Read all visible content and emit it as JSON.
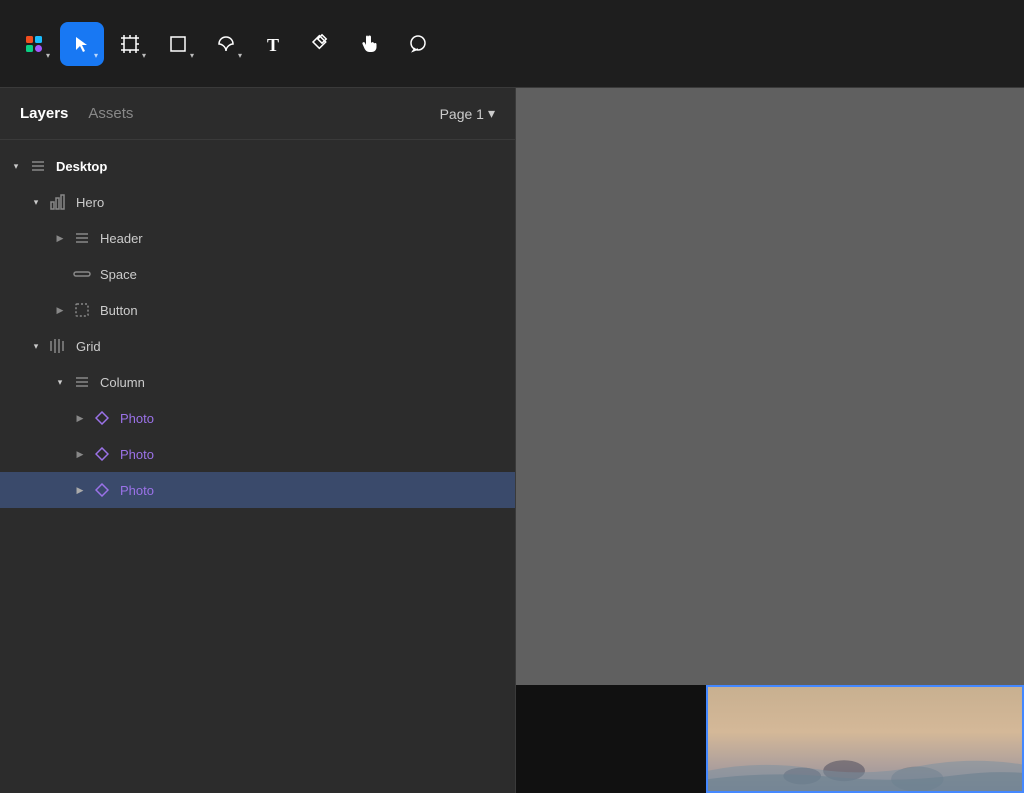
{
  "toolbar": {
    "tools": [
      {
        "name": "figma-menu",
        "icon": "⊞",
        "label": "Figma Menu",
        "hasChevron": true,
        "active": false
      },
      {
        "name": "move-tool",
        "icon": "▷",
        "label": "Move Tool",
        "hasChevron": true,
        "active": true
      },
      {
        "name": "frame-tool",
        "icon": "⊡",
        "label": "Frame Tool",
        "hasChevron": true,
        "active": false
      },
      {
        "name": "shape-tool",
        "icon": "□",
        "label": "Shape Tool",
        "hasChevron": true,
        "active": false
      },
      {
        "name": "pen-tool",
        "icon": "✒",
        "label": "Pen Tool",
        "hasChevron": true,
        "active": false
      },
      {
        "name": "text-tool",
        "icon": "T",
        "label": "Text Tool",
        "hasChevron": false,
        "active": false
      },
      {
        "name": "component-tool",
        "icon": "⊞",
        "label": "Component Tool",
        "hasChevron": false,
        "active": false
      },
      {
        "name": "hand-tool",
        "icon": "✋",
        "label": "Hand Tool",
        "hasChevron": false,
        "active": false
      },
      {
        "name": "comment-tool",
        "icon": "◯",
        "label": "Comment Tool",
        "hasChevron": false,
        "active": false
      }
    ]
  },
  "sidebar": {
    "tabs": [
      {
        "id": "layers",
        "label": "Layers",
        "active": true
      },
      {
        "id": "assets",
        "label": "Assets",
        "active": false
      }
    ],
    "page_selector": {
      "label": "Page 1",
      "chevron": "▾"
    },
    "layers": [
      {
        "id": "desktop",
        "label": "Desktop",
        "indent": 0,
        "icon": "list",
        "bold": true,
        "chevron": "open",
        "color": "white"
      },
      {
        "id": "hero",
        "label": "Hero",
        "indent": 1,
        "icon": "chart",
        "bold": false,
        "chevron": "open",
        "color": "default"
      },
      {
        "id": "header",
        "label": "Header",
        "indent": 2,
        "icon": "list",
        "bold": false,
        "chevron": "right",
        "color": "default"
      },
      {
        "id": "space",
        "label": "Space",
        "indent": 2,
        "icon": "space",
        "bold": false,
        "chevron": "none",
        "color": "default"
      },
      {
        "id": "button",
        "label": "Button",
        "indent": 2,
        "icon": "dashed",
        "bold": false,
        "chevron": "right",
        "color": "default"
      },
      {
        "id": "grid",
        "label": "Grid",
        "indent": 1,
        "icon": "grid",
        "bold": false,
        "chevron": "open",
        "color": "default"
      },
      {
        "id": "column",
        "label": "Column",
        "indent": 2,
        "icon": "list",
        "bold": false,
        "chevron": "open",
        "color": "default"
      },
      {
        "id": "photo1",
        "label": "Photo",
        "indent": 3,
        "icon": "diamond",
        "bold": false,
        "chevron": "right",
        "color": "purple",
        "selected": false
      },
      {
        "id": "photo2",
        "label": "Photo",
        "indent": 3,
        "icon": "diamond",
        "bold": false,
        "chevron": "right",
        "color": "purple",
        "selected": false
      },
      {
        "id": "photo3",
        "label": "Photo",
        "indent": 3,
        "icon": "diamond",
        "bold": false,
        "chevron": "right",
        "color": "purple",
        "selected": true
      }
    ]
  }
}
